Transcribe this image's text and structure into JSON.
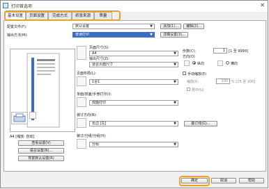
{
  "window": {
    "title": "打印首选项",
    "close_glyph": "✕"
  },
  "tabs": [
    {
      "label": "基本设置"
    },
    {
      "label": "页面设置"
    },
    {
      "label": "完成方式"
    },
    {
      "label": "纸张来源"
    },
    {
      "label": "质量"
    }
  ],
  "profile": {
    "label": "配置文件(F):",
    "value": "默认设置",
    "add_button": "添加(1)...",
    "edit_button": "编辑(2)..."
  },
  "output": {
    "label": "输出方法(M):",
    "value": "普通打印",
    "details_button": "详细设置(3)..."
  },
  "preview_panel": {
    "status_text": "A4 [缩放: 自动]",
    "view_settings_button": "查看设置(V)",
    "language_settings_button": "语言设置(N)...",
    "restore_defaults_button": "恢复默认设置(R)"
  },
  "page_size": {
    "label": "页面尺寸(S):",
    "value": "A4"
  },
  "output_size": {
    "label": "输出尺寸(Z):",
    "value": "适合页面尺寸"
  },
  "pages_per_sheet": {
    "label": "页面布局(L):",
    "value": "1合1"
  },
  "print_style": {
    "label": "单面/双面/手册打印(I):",
    "value": "双面打印"
  },
  "binding_location": {
    "label": "装订方向(B):",
    "value": "长边 [左]"
  },
  "collate": {
    "label": "装订/分组/分组(H):",
    "value": "分组"
  },
  "copies": {
    "label": "份数(C):",
    "value": "1",
    "range": "[1 至 9999]"
  },
  "orientation": {
    "label": "方向(O)",
    "portrait": "纵向",
    "landscape": "横向"
  },
  "manual_scaling": {
    "label": "手动缩放(E)",
    "scale_label": "缩放(I):",
    "value": "100",
    "range": "% [25 至 200]",
    "center_label": "居中(U)"
  },
  "gutter_button": "装订线(G)...",
  "footer": {
    "ok": "确定",
    "cancel": "取消",
    "help": "帮助"
  },
  "colors": {
    "accent": "#f0a020",
    "selected": "#3b6dc4"
  }
}
